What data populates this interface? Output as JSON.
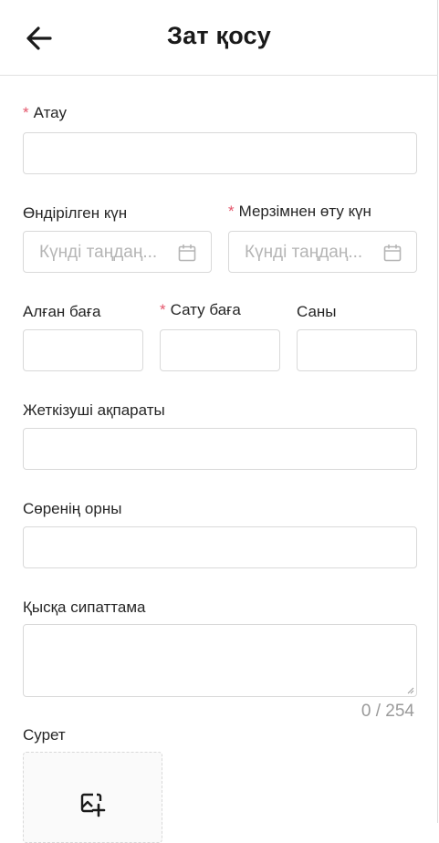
{
  "header": {
    "title": "Зат қосу",
    "back_icon": "arrow-left-icon"
  },
  "form": {
    "name": {
      "label": "Атау",
      "required": true,
      "value": ""
    },
    "production_date": {
      "label": "Өндірілген күн",
      "required": false,
      "placeholder": "Күнді таңдаң..."
    },
    "expiry_date": {
      "label": "Мерзімнен өту күн",
      "required": true,
      "placeholder": "Күнді таңдаң..."
    },
    "purchase_price": {
      "label": "Алған баға",
      "required": false,
      "value": ""
    },
    "sale_price": {
      "label": "Сату баға",
      "required": true,
      "value": ""
    },
    "quantity": {
      "label": "Саны",
      "required": false,
      "value": ""
    },
    "supplier": {
      "label": "Жеткізуші ақпараты",
      "required": false,
      "value": ""
    },
    "shelf_location": {
      "label": "Сөренің орны",
      "required": false,
      "value": ""
    },
    "description": {
      "label": "Қысқа сипаттама",
      "required": false,
      "value": "",
      "counter": "0 / 254"
    },
    "image": {
      "label": "Сурет",
      "upload_icon": "add-image-icon"
    }
  },
  "colors": {
    "required_mark": "#e4566b",
    "border": "#d9d9d9",
    "placeholder": "#b5b5b5"
  }
}
